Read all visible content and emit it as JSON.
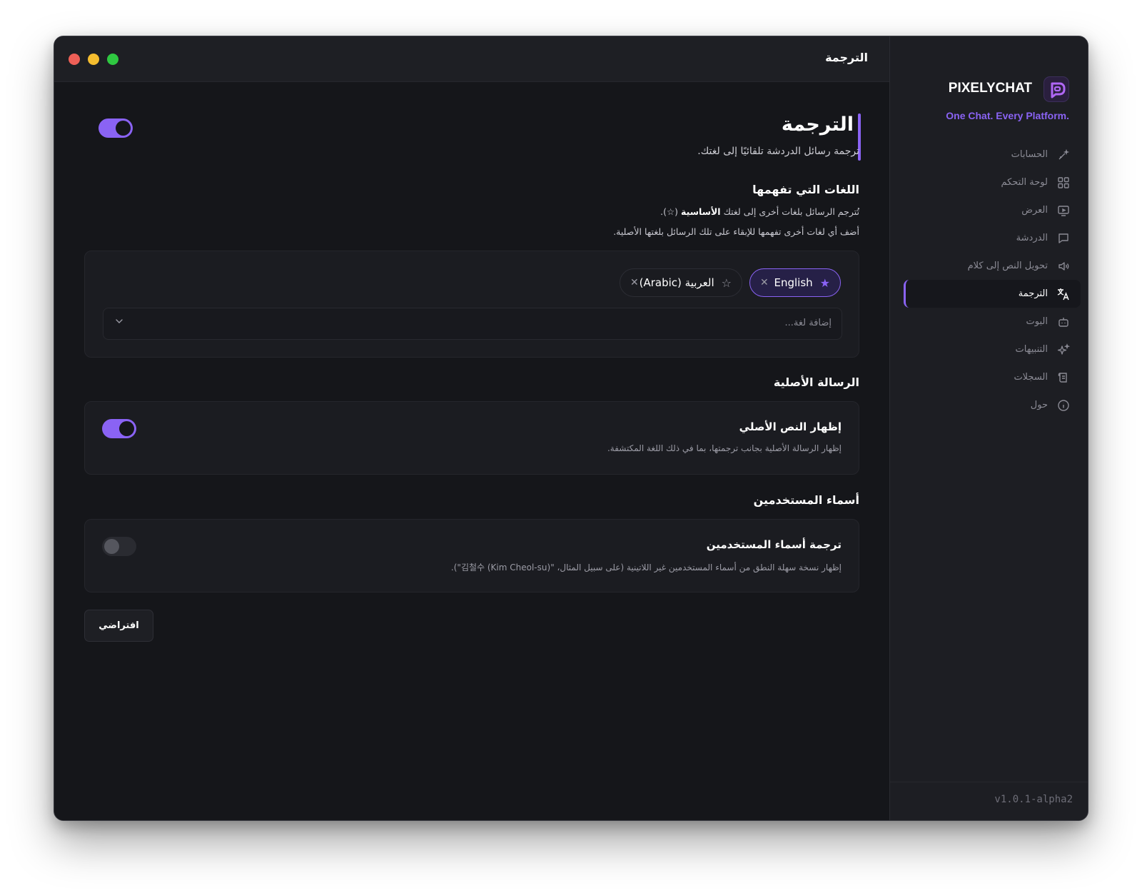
{
  "window": {
    "title": "الترجمة"
  },
  "brand": {
    "name": "PIXELYCHAT",
    "tagline": ".One Chat. Every Platform",
    "accent": "#8a63f4"
  },
  "sidebar": {
    "items": [
      {
        "label": "الحسابات",
        "icon": "accounts-icon",
        "active": false
      },
      {
        "label": "لوحة التحكم",
        "icon": "dashboard-grid-icon",
        "active": false
      },
      {
        "label": "العرض",
        "icon": "display-icon",
        "active": false
      },
      {
        "label": "الدردشة",
        "icon": "chat-bubble-icon",
        "active": false
      },
      {
        "label": "تحويل النص إلى كلام",
        "icon": "speaker-icon",
        "active": false
      },
      {
        "label": "الترجمة",
        "icon": "translate-icon",
        "active": true
      },
      {
        "label": "البوت",
        "icon": "bot-icon",
        "active": false
      },
      {
        "label": "التنبيهات",
        "icon": "sparkles-icon",
        "active": false
      },
      {
        "label": "السجلات",
        "icon": "logs-icon",
        "active": false
      },
      {
        "label": "حول",
        "icon": "info-icon",
        "active": false
      }
    ],
    "version": "v1.0.1-alpha2"
  },
  "page": {
    "title": "الترجمة",
    "subtitle": "ترجمة رسائل الدردشة تلقائيًا إلى لغتك.",
    "enabled": true
  },
  "languages": {
    "title": "اللغات التي تفهمها",
    "desc1_prefix": "تُترجم الرسائل بلغات أخرى إلى لغتك",
    "desc1_bold": "الأساسية",
    "desc1_suffix": "(☆).",
    "desc2": "أضف أي لغات أخرى تفهمها للإبقاء على تلك الرسائل بلغتها الأصلية.",
    "chips": [
      {
        "label": "English",
        "primary": true
      },
      {
        "label": "العربية (Arabic)",
        "primary": false
      }
    ],
    "add_placeholder": "إضافة لغة..."
  },
  "original": {
    "section_title": "الرسالة الأصلية",
    "option_title": "إظهار النص الأصلي",
    "option_desc": "إظهار الرسالة الأصلية بجانب ترجمتها، بما في ذلك اللغة المكتشفة.",
    "enabled": true
  },
  "usernames": {
    "section_title": "أسماء المستخدمين",
    "option_title": "ترجمة أسماء المستخدمين",
    "option_desc": "إظهار نسخة سهلة النطق من أسماء المستخدمين غير اللاتينية (على سبيل المثال، \"김철수 (Kim Cheol-su)\").",
    "enabled": false
  },
  "footer": {
    "default_label": "افتراضي"
  }
}
